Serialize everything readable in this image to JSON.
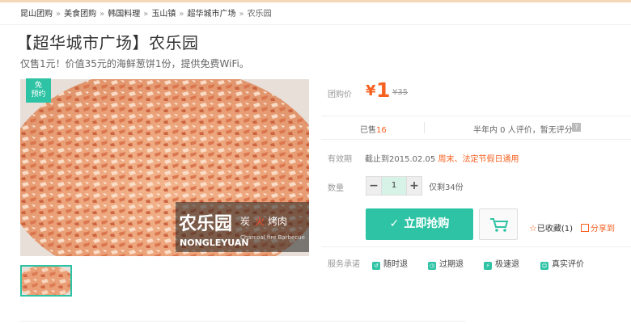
{
  "breadcrumb": [
    "昆山团购",
    "美食团购",
    "韩国料理",
    "玉山镇",
    "超华城市广场",
    "农乐园"
  ],
  "breadcrumb_separator": "»",
  "title": "【超华城市广场】农乐园",
  "subtitle": "仅售1元！价值35元的海鲜葱饼1份，提供免费WiFi。",
  "badge": {
    "line1": "免",
    "line2": "预约"
  },
  "image_text": {
    "brand": "农乐园",
    "brand_en": "NONGLEYUAN",
    "tag1": "炭",
    "tag2": "火",
    "tag3": "烤肉",
    "tag_en": "Charcoal fire Barbecue"
  },
  "price": {
    "label": "团购价",
    "symbol": "¥",
    "value": "1",
    "original": "¥35"
  },
  "stats": {
    "sold_label": "已售",
    "sold_count": "16",
    "review_text": "半年内 0 人评价，暂无评分",
    "help": "?"
  },
  "validity": {
    "label": "有效期",
    "date_text": "截止到2015.02.05",
    "note": "周末、法定节假日通用"
  },
  "quantity": {
    "label": "数量",
    "minus": "−",
    "value": "1",
    "plus": "+",
    "remaining": "仅剩34份"
  },
  "actions": {
    "buy_label": "立即抢购",
    "favorite": "已收藏(1)",
    "share": "分享到"
  },
  "services": {
    "label": "服务承诺",
    "items": [
      "随时退",
      "过期退",
      "极速退",
      "真实评价"
    ]
  },
  "colors": {
    "accent": "#2ec3a4",
    "price": "#f76120"
  }
}
